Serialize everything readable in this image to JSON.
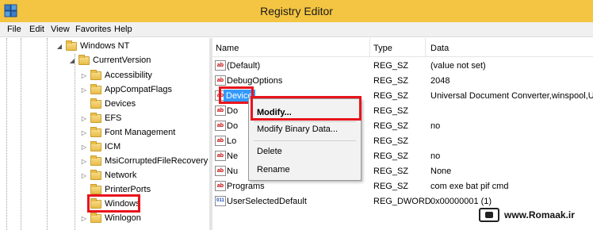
{
  "window": {
    "title": "Registry Editor"
  },
  "menu": [
    "File",
    "Edit",
    "View",
    "Favorites",
    "Help"
  ],
  "tree": {
    "items": [
      {
        "label": "Windows NT",
        "expander": "◢"
      },
      {
        "label": "CurrentVersion",
        "expander": "◢"
      },
      {
        "label": "Accessibility",
        "expander": "▷"
      },
      {
        "label": "AppCompatFlags",
        "expander": "▷"
      },
      {
        "label": "Devices",
        "expander": ""
      },
      {
        "label": "EFS",
        "expander": "▷"
      },
      {
        "label": "Font Management",
        "expander": "▷"
      },
      {
        "label": "ICM",
        "expander": "▷"
      },
      {
        "label": "MsiCorruptedFileRecovery",
        "expander": "▷"
      },
      {
        "label": "Network",
        "expander": "▷"
      },
      {
        "label": "PrinterPorts",
        "expander": ""
      },
      {
        "label": "Windows",
        "expander": ""
      },
      {
        "label": "Winlogon",
        "expander": "▷"
      }
    ]
  },
  "list": {
    "headers": {
      "name": "Name",
      "type": "Type",
      "data": "Data"
    },
    "rows": [
      {
        "name": "(Default)",
        "type": "REG_SZ",
        "data": "(value not set)",
        "icon": "ab"
      },
      {
        "name": "DebugOptions",
        "type": "REG_SZ",
        "data": "2048",
        "icon": "ab"
      },
      {
        "name": "Device",
        "type": "REG_SZ",
        "data": "Universal Document Converter,winspool,UDC",
        "icon": "ab"
      },
      {
        "name": "Do",
        "type": "REG_SZ",
        "data": "",
        "icon": "ab"
      },
      {
        "name": "Do",
        "type": "REG_SZ",
        "data": "no",
        "icon": "ab"
      },
      {
        "name": "Lo",
        "type": "REG_SZ",
        "data": "",
        "icon": "ab"
      },
      {
        "name": "Ne",
        "type": "REG_SZ",
        "data": "no",
        "icon": "ab"
      },
      {
        "name": "Nu",
        "type": "REG_SZ",
        "data": "None",
        "icon": "ab"
      },
      {
        "name": "Programs",
        "type": "REG_SZ",
        "data": "com exe bat pif cmd",
        "icon": "ab"
      },
      {
        "name": "UserSelectedDefault",
        "type": "REG_DWORD",
        "data": "0x00000001 (1)",
        "icon": "011"
      }
    ]
  },
  "context_menu": {
    "modify": "Modify...",
    "modify_binary": "Modify Binary Data...",
    "delete": "Delete",
    "rename": "Rename"
  },
  "watermark": {
    "text": "www.Romaak.ir"
  },
  "colors": {
    "titlebar": "#f4c542",
    "selection": "#3399ff",
    "highlight": "#e8141c"
  }
}
